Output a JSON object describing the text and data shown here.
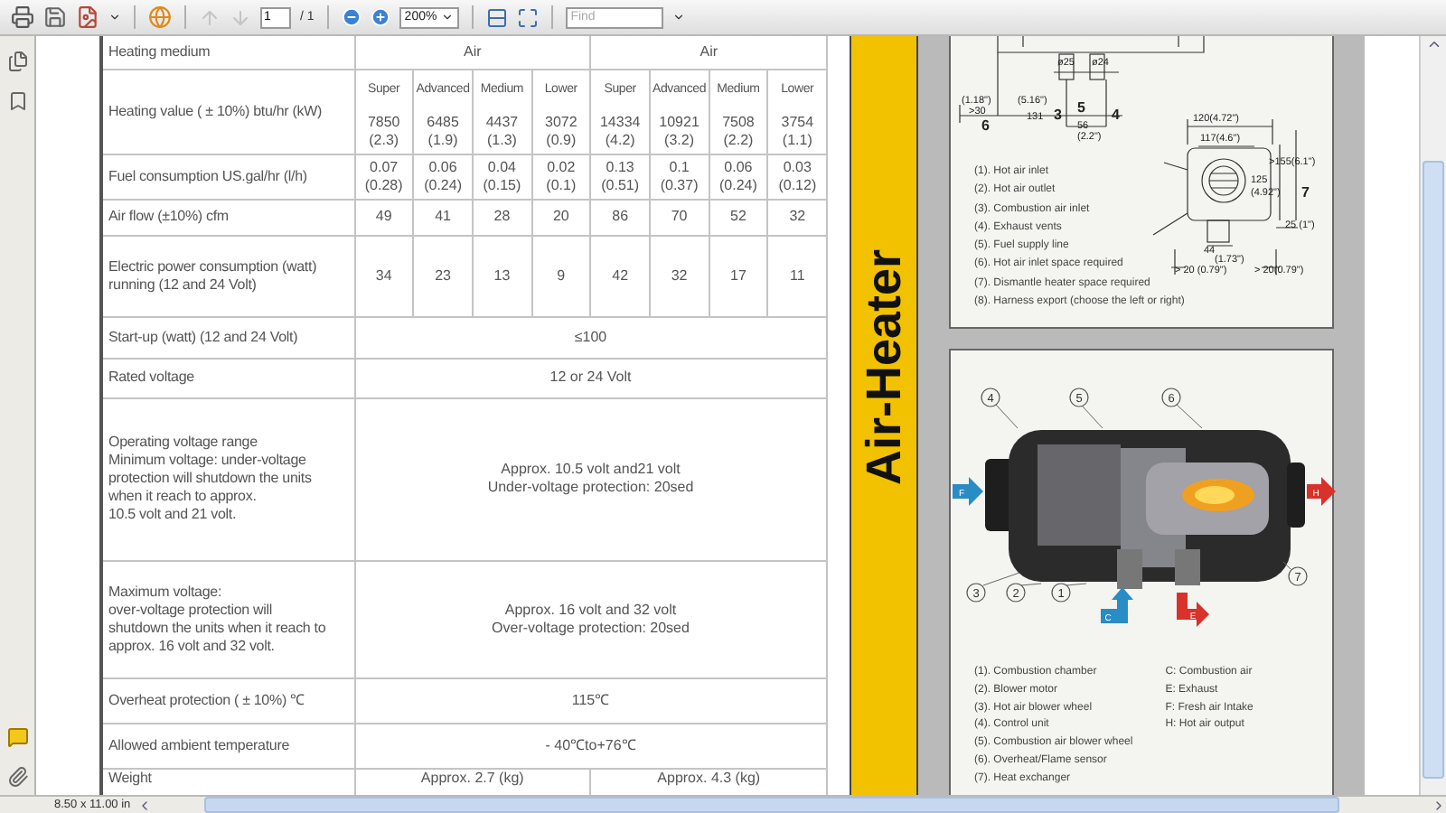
{
  "toolbar": {
    "nav_buttons": [
      {
        "disabled": true
      },
      {
        "disabled": true
      }
    ],
    "page_input": "1",
    "page_total": "/ 1",
    "zoom": "200%",
    "find": {
      "placeholder": "Find"
    }
  },
  "spec_table": {
    "rows": [
      {
        "kind": "groups",
        "label": [
          "Heating medium"
        ],
        "cells": [
          {
            "lines": [
              "Air"
            ],
            "colspan": 4
          },
          {
            "lines": [
              "Air"
            ],
            "colspan": 4
          }
        ]
      },
      {
        "kind": "levels",
        "label": [
          "Heating value ( ± 10%) btu/hr (kW)"
        ],
        "levels": [
          "Super",
          "Advanced",
          "Medium",
          "Lower",
          "Super",
          "Advanced",
          "Medium",
          "Lower"
        ],
        "cells": [
          [
            "7850",
            "(2.3)"
          ],
          [
            "6485",
            "(1.9)"
          ],
          [
            "4437",
            "(1.3)"
          ],
          [
            "3072",
            "(0.9)"
          ],
          [
            "14334",
            "(4.2)"
          ],
          [
            "10921",
            "(3.2)"
          ],
          [
            "7508",
            "(2.2)"
          ],
          [
            "3754",
            "(1.1)"
          ]
        ]
      },
      {
        "kind": "each",
        "label": [
          "Fuel consumption US.gal/hr (l/h)"
        ],
        "cells": [
          [
            "0.07",
            "(0.28)"
          ],
          [
            "0.06",
            "(0.24)"
          ],
          [
            "0.04",
            "(0.15)"
          ],
          [
            "0.02",
            "(0.1)"
          ],
          [
            "0.13",
            "(0.51)"
          ],
          [
            "0.1",
            "(0.37)"
          ],
          [
            "0.06",
            "(0.24)"
          ],
          [
            "0.03",
            "(0.12)"
          ]
        ]
      },
      {
        "kind": "each",
        "label": [
          "Air flow (±10%) cfm"
        ],
        "cells": [
          [
            "49"
          ],
          [
            "41"
          ],
          [
            "28"
          ],
          [
            "20"
          ],
          [
            "86"
          ],
          [
            "70"
          ],
          [
            "52"
          ],
          [
            "32"
          ]
        ]
      },
      {
        "kind": "each",
        "label": [
          "Electric power consumption (watt)",
          "running (12 and 24 Volt)"
        ],
        "cells": [
          [
            "34"
          ],
          [
            "23"
          ],
          [
            "13"
          ],
          [
            "9"
          ],
          [
            "42"
          ],
          [
            "32"
          ],
          [
            "17"
          ],
          [
            "11"
          ]
        ]
      },
      {
        "kind": "span",
        "label": [
          "Start-up (watt) (12 and 24 Volt)"
        ],
        "cells": [
          {
            "lines": [
              "≤100"
            ],
            "colspan": 8
          }
        ]
      },
      {
        "kind": "span",
        "label": [
          "Rated voltage"
        ],
        "cells": [
          {
            "lines": [
              "12 or 24 Volt"
            ],
            "colspan": 8
          }
        ]
      },
      {
        "kind": "span",
        "label": [
          "Operating voltage range",
          "Minimum voltage: under-voltage",
          "protection will shutdown the units",
          "when it reach to approx.",
          "10.5 volt and 21 volt."
        ],
        "cells": [
          {
            "lines": [
              "Approx. 10.5 volt and21 volt",
              "Under-voltage protection: 20sed"
            ],
            "colspan": 8
          }
        ]
      },
      {
        "kind": "span",
        "label": [
          "Maximum voltage:",
          "over-voltage protection will",
          "shutdown the units when it reach to",
          "approx. 16 volt and 32 volt."
        ],
        "cells": [
          {
            "lines": [
              "Approx. 16 volt and 32 volt",
              "Over-voltage protection: 20sed"
            ],
            "colspan": 8
          }
        ]
      },
      {
        "kind": "span",
        "label": [
          "Overheat protection ( ± 10%) ℃"
        ],
        "cells": [
          {
            "lines": [
              "115℃"
            ],
            "colspan": 8
          }
        ]
      },
      {
        "kind": "span",
        "label": [
          "Allowed ambient temperature"
        ],
        "cells": [
          {
            "lines": [
              "- 40℃to+76℃"
            ],
            "colspan": 8
          }
        ]
      },
      {
        "kind": "groups",
        "label": [
          "Weight"
        ],
        "cells": [
          {
            "lines": [
              "Approx.  2.7 (kg)"
            ],
            "colspan": 4
          },
          {
            "lines": [
              "Approx.  4.3 (kg)"
            ],
            "colspan": 4
          }
        ]
      }
    ]
  },
  "side_band": {
    "title": "Air-Heater"
  },
  "dimension_panel": {
    "labels": [
      {
        "text": "ø25",
        "kind": "size"
      },
      {
        "text": "ø24",
        "kind": "size"
      },
      {
        "text": "(1.18\")",
        "kind": "size"
      },
      {
        "text": ">30",
        "kind": "size"
      },
      {
        "text": "6",
        "kind": "marker"
      },
      {
        "text": "(5.16\")",
        "kind": "size"
      },
      {
        "text": "131",
        "kind": "size"
      },
      {
        "text": "3",
        "kind": "marker"
      },
      {
        "text": "5",
        "kind": "marker"
      },
      {
        "text": "4",
        "kind": "marker"
      },
      {
        "text": "56",
        "kind": "size"
      },
      {
        "text": "(2.2\")",
        "kind": "size"
      },
      {
        "text": "120(4.72\")",
        "kind": "size"
      },
      {
        "text": "117(4.6\")",
        "kind": "size"
      },
      {
        "text": ">155(6.1\")",
        "kind": "size"
      },
      {
        "text": "125",
        "kind": "size"
      },
      {
        "text": "(4.92\")",
        "kind": "size"
      },
      {
        "text": "7",
        "kind": "marker"
      },
      {
        "text": "25 (1\")",
        "kind": "size"
      },
      {
        "text": "44",
        "kind": "size"
      },
      {
        "text": "(1.73\")",
        "kind": "size"
      },
      {
        "text": "> 20 (0.79\")",
        "kind": "size"
      },
      {
        "text": "> 20(0.79\")",
        "kind": "size"
      }
    ],
    "legend": [
      "(1). Hot air inlet",
      "(2). Hot air outlet",
      "(3). Combustion air inlet",
      "(4). Exhaust vents",
      "(5). Fuel supply line",
      "(6). Hot air inlet space required",
      "(7). Dismantle heater space required",
      "(8). Harness export (choose the left or right)"
    ]
  },
  "cutaway_panel": {
    "callouts": [
      "4",
      "5",
      "6",
      "3",
      "2",
      "1",
      "7"
    ],
    "flow_arrows": [
      "F",
      "H",
      "C",
      "E"
    ],
    "legend": [
      "(1). Combustion chamber",
      "(2). Blower motor",
      "(3). Hot air blower wheel",
      "(4). Control unit",
      "(5). Combustion air blower wheel",
      "(6). Overheat/Flame sensor",
      "(7). Heat exchanger"
    ],
    "key": [
      "C: Combustion air",
      "E: Exhaust",
      "F: Fresh air Intake",
      "H: Hot air output"
    ]
  },
  "status_bar": {
    "page_size": "8.50 x 11.00 in"
  }
}
